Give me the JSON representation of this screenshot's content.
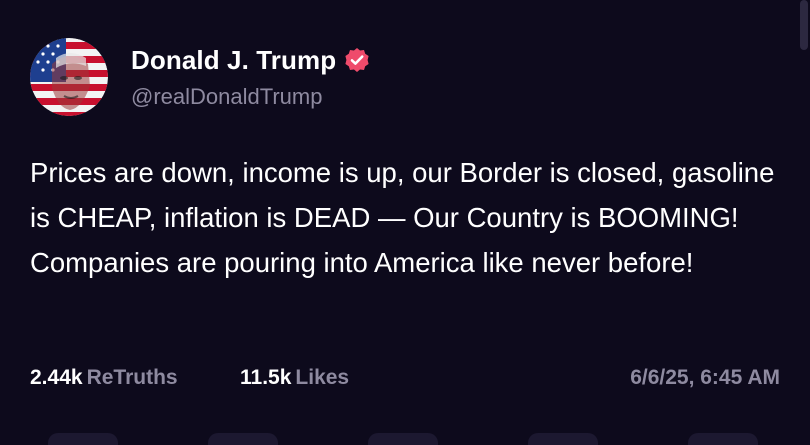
{
  "author": {
    "display_name": "Donald J. Trump",
    "handle": "@realDonaldTrump",
    "avatar": "avatar-image",
    "verified_icon": "verified-badge-icon"
  },
  "post": {
    "text": "Prices are down, income is up, our Border is closed, gasoline is CHEAP, inflation is DEAD — Our Country is BOOMING! Companies are pouring into America like never before!"
  },
  "stats": {
    "retruths_count": "2.44k",
    "retruths_label": "ReTruths",
    "likes_count": "11.5k",
    "likes_label": "Likes",
    "timestamp": "6/6/25, 6:45 AM"
  },
  "colors": {
    "background": "#0d0a1c",
    "text_primary": "#ffffff",
    "text_secondary": "#8e8aa0",
    "verified": "#ef4b6b"
  }
}
